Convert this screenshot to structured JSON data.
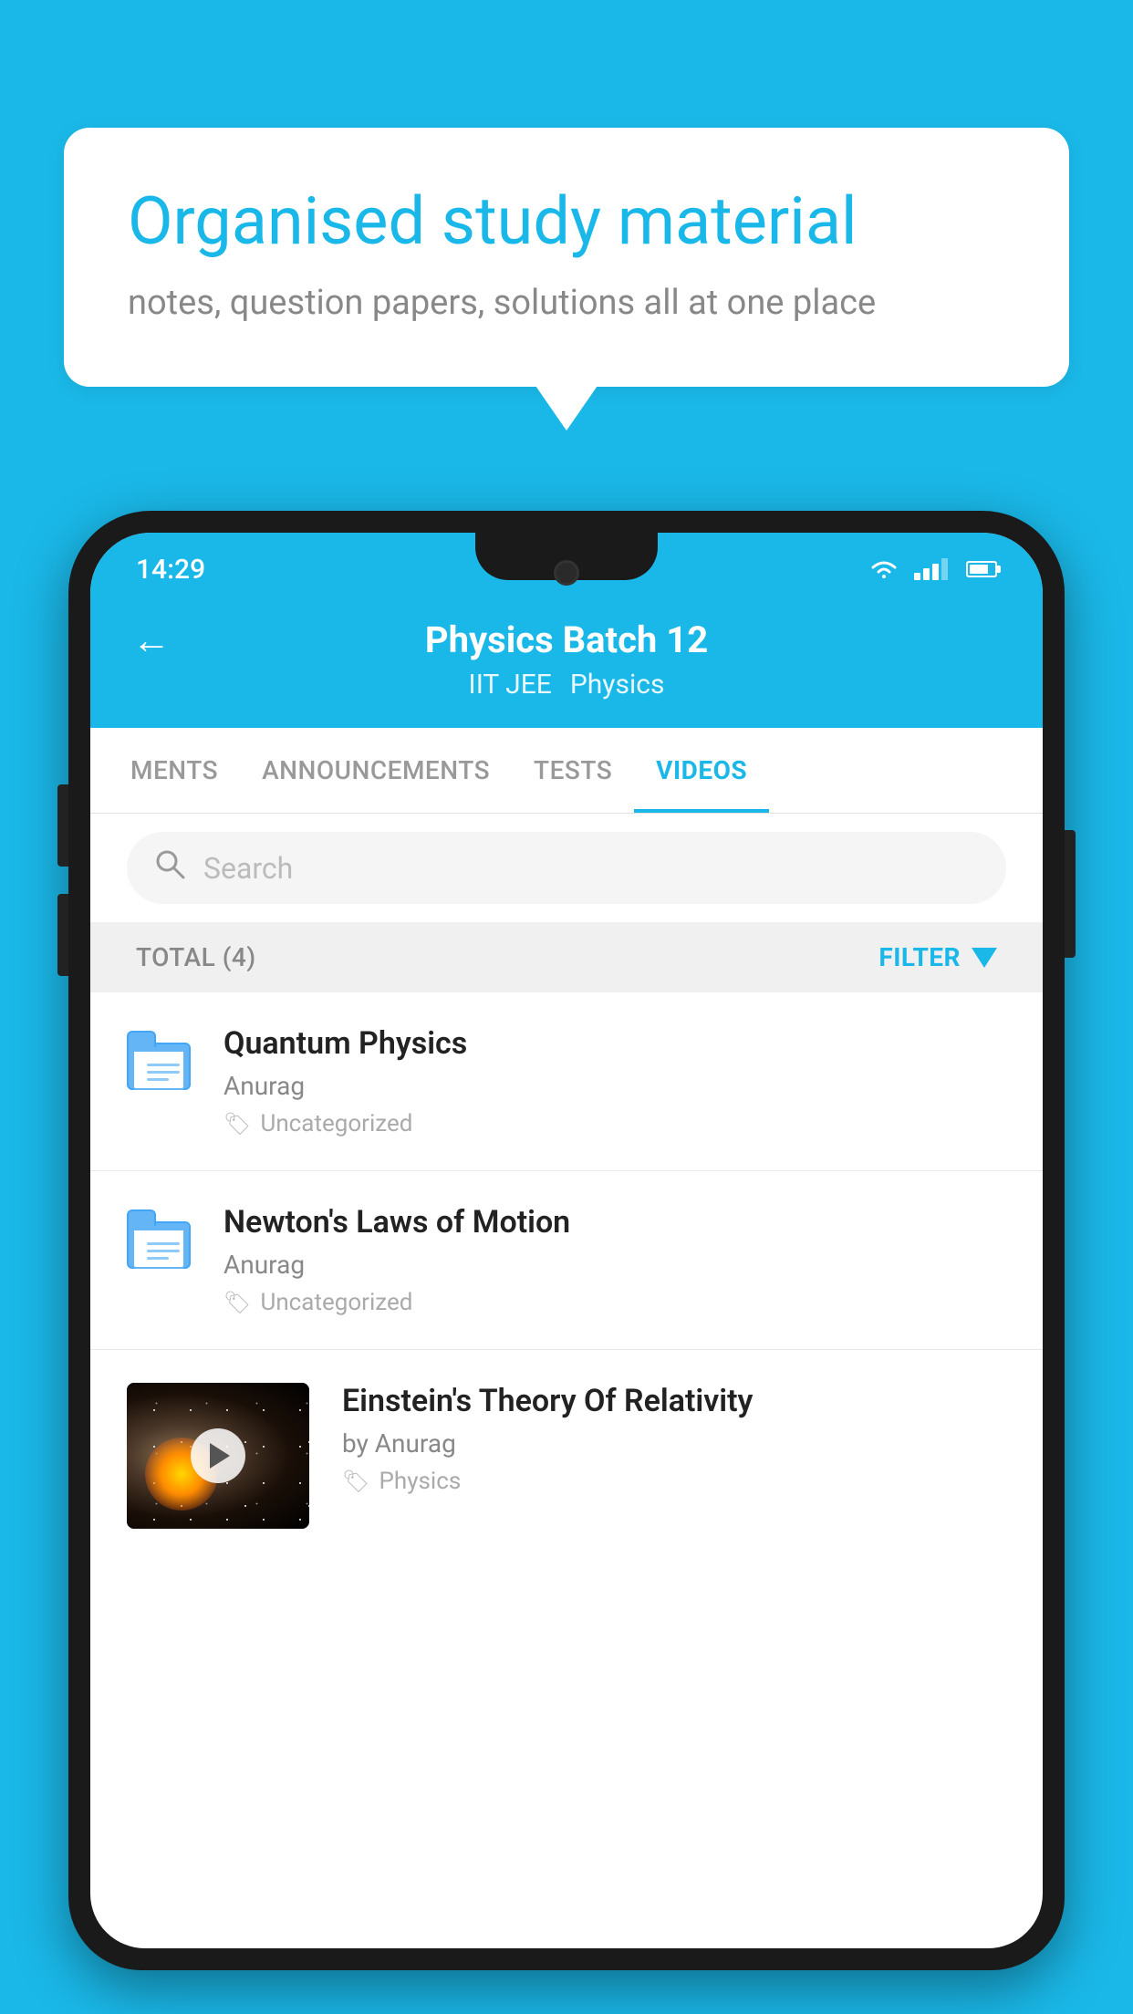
{
  "bubble": {
    "title": "Organised study material",
    "subtitle": "notes, question papers, solutions all at one place"
  },
  "status_bar": {
    "time": "14:29"
  },
  "header": {
    "title": "Physics Batch 12",
    "tag1": "IIT JEE",
    "tag2": "Physics",
    "back_label": "←"
  },
  "tabs": [
    {
      "label": "MENTS",
      "active": false
    },
    {
      "label": "ANNOUNCEMENTS",
      "active": false
    },
    {
      "label": "TESTS",
      "active": false
    },
    {
      "label": "VIDEOS",
      "active": true
    }
  ],
  "search": {
    "placeholder": "Search"
  },
  "filter_bar": {
    "total_label": "TOTAL (4)",
    "filter_label": "FILTER"
  },
  "videos": [
    {
      "title": "Quantum Physics",
      "author": "Anurag",
      "tag": "Uncategorized",
      "type": "folder"
    },
    {
      "title": "Newton's Laws of Motion",
      "author": "Anurag",
      "tag": "Uncategorized",
      "type": "folder"
    },
    {
      "title": "Einstein's Theory Of Relativity",
      "author": "by Anurag",
      "tag": "Physics",
      "type": "video"
    }
  ]
}
